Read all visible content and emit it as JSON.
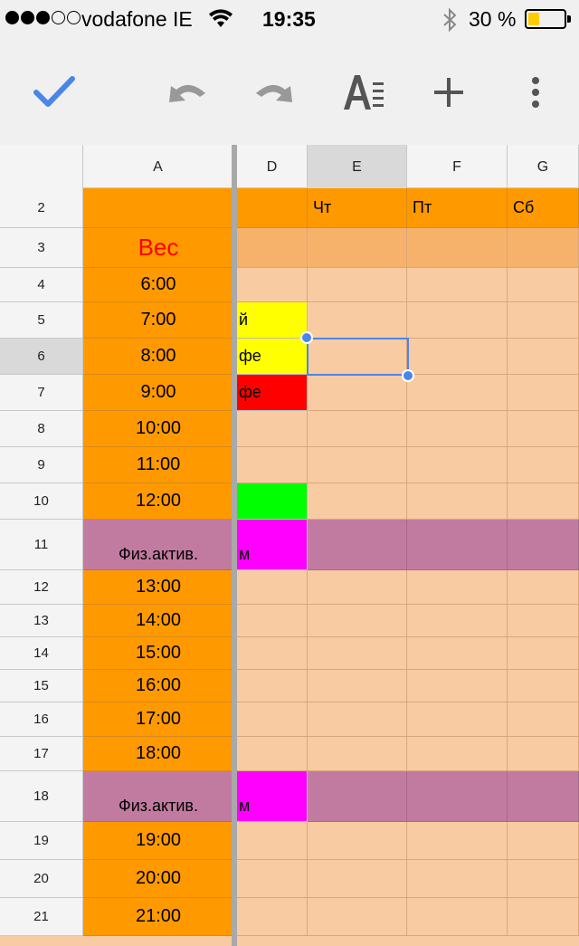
{
  "status_bar": {
    "carrier": "vodafone IE",
    "time": "19:35",
    "battery_percent": "30 %",
    "signal_bars_filled": 3,
    "signal_bars_total": 5
  },
  "toolbar": {
    "confirm_icon": "checkmark-icon",
    "undo_icon": "undo-icon",
    "redo_icon": "redo-icon",
    "format_icon": "text-format-icon",
    "insert_icon": "plus-icon",
    "more_icon": "more-vertical-icon",
    "accent_color": "#4a86e8"
  },
  "sheet": {
    "columns": [
      "A",
      "D",
      "E",
      "F",
      "G"
    ],
    "active_column": "E",
    "active_row": "6",
    "rows": [
      {
        "num": "2",
        "a": "",
        "d": "",
        "e": "Чт",
        "f": "Пт",
        "g": "Сб"
      },
      {
        "num": "3",
        "a": "Вес",
        "d": "",
        "e": "",
        "f": "",
        "g": ""
      },
      {
        "num": "4",
        "a": "6:00",
        "d": "",
        "e": "",
        "f": "",
        "g": ""
      },
      {
        "num": "5",
        "a": "7:00",
        "d": "й",
        "e": "",
        "f": "",
        "g": ""
      },
      {
        "num": "6",
        "a": "8:00",
        "d": "фе",
        "e": "",
        "f": "",
        "g": ""
      },
      {
        "num": "7",
        "a": "9:00",
        "d": "фе",
        "e": "",
        "f": "",
        "g": ""
      },
      {
        "num": "8",
        "a": "10:00",
        "d": "",
        "e": "",
        "f": "",
        "g": ""
      },
      {
        "num": "9",
        "a": "11:00",
        "d": "",
        "e": "",
        "f": "",
        "g": ""
      },
      {
        "num": "10",
        "a": "12:00",
        "d": "",
        "e": "",
        "f": "",
        "g": ""
      },
      {
        "num": "11",
        "a": "Физ.актив.",
        "d": "м",
        "e": "",
        "f": "",
        "g": ""
      },
      {
        "num": "12",
        "a": "13:00",
        "d": "",
        "e": "",
        "f": "",
        "g": ""
      },
      {
        "num": "13",
        "a": "14:00",
        "d": "",
        "e": "",
        "f": "",
        "g": ""
      },
      {
        "num": "14",
        "a": "15:00",
        "d": "",
        "e": "",
        "f": "",
        "g": ""
      },
      {
        "num": "15",
        "a": "16:00",
        "d": "",
        "e": "",
        "f": "",
        "g": ""
      },
      {
        "num": "16",
        "a": "17:00",
        "d": "",
        "e": "",
        "f": "",
        "g": ""
      },
      {
        "num": "17",
        "a": "18:00",
        "d": "",
        "e": "",
        "f": "",
        "g": ""
      },
      {
        "num": "18",
        "a": "Физ.актив.",
        "d": "м",
        "e": "",
        "f": "",
        "g": ""
      },
      {
        "num": "19",
        "a": "19:00",
        "d": "",
        "e": "",
        "f": "",
        "g": ""
      },
      {
        "num": "20",
        "a": "20:00",
        "d": "",
        "e": "",
        "f": "",
        "g": ""
      },
      {
        "num": "21",
        "a": "21:00",
        "d": "",
        "e": "",
        "f": "",
        "g": ""
      }
    ],
    "colors": {
      "orange": "#ff9900",
      "peach": "#f8cba3",
      "peach_dark": "#f6b26b",
      "purple": "#c27ba0",
      "yellow": "#ffff00",
      "red": "#ff0000",
      "green": "#00ff00",
      "magenta": "#ff00ff",
      "weight_text": "#ff0000"
    }
  }
}
